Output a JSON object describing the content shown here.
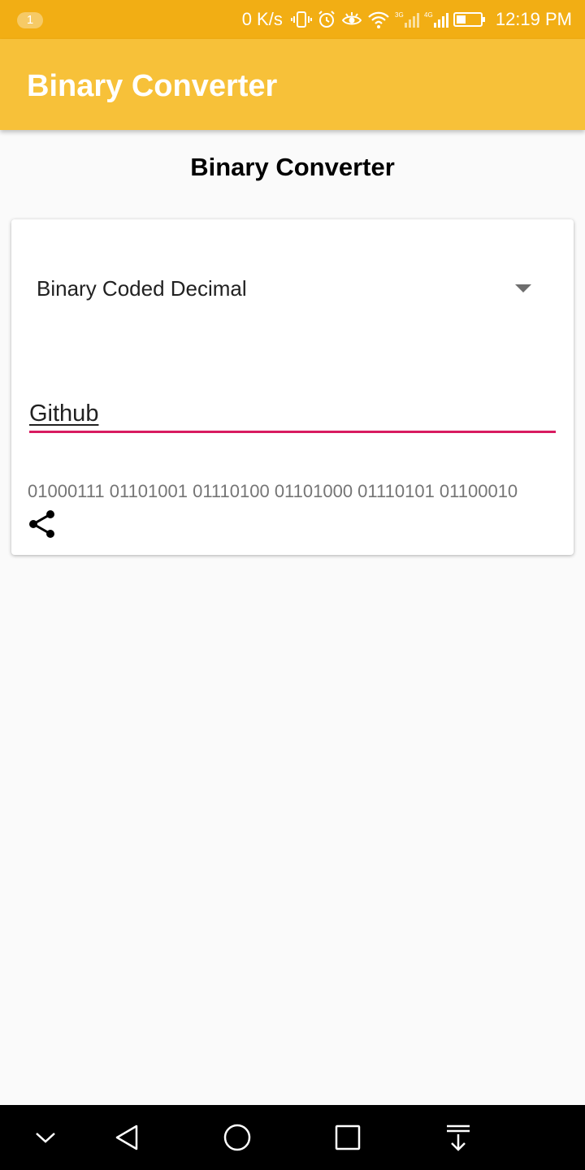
{
  "status_bar": {
    "notification_count": "1",
    "net_speed": "0 K/s",
    "network_3g": "3G",
    "network_4g": "4G",
    "time": "12:19 PM",
    "icons": [
      "vibrate-icon",
      "alarm-icon",
      "eye-icon",
      "wifi-icon",
      "signal-3g-icon",
      "signal-4g-icon",
      "battery-icon"
    ]
  },
  "app_bar": {
    "title": "Binary Converter"
  },
  "main": {
    "heading": "Binary Converter",
    "spinner": {
      "selected": "Binary Coded Decimal"
    },
    "input": {
      "value": "Github"
    },
    "output": "01000111 01101001 01110100 01101000 01110101 01100010",
    "share_icon": "share-icon"
  },
  "nav_bar": {
    "icons": [
      "chevron-down-icon",
      "back-icon",
      "home-icon",
      "recents-icon",
      "notification-pull-icon"
    ]
  },
  "colors": {
    "status_bar": "#f2ae14",
    "app_bar": "#f7c139",
    "accent": "#d81b60",
    "background": "#fafafa"
  }
}
